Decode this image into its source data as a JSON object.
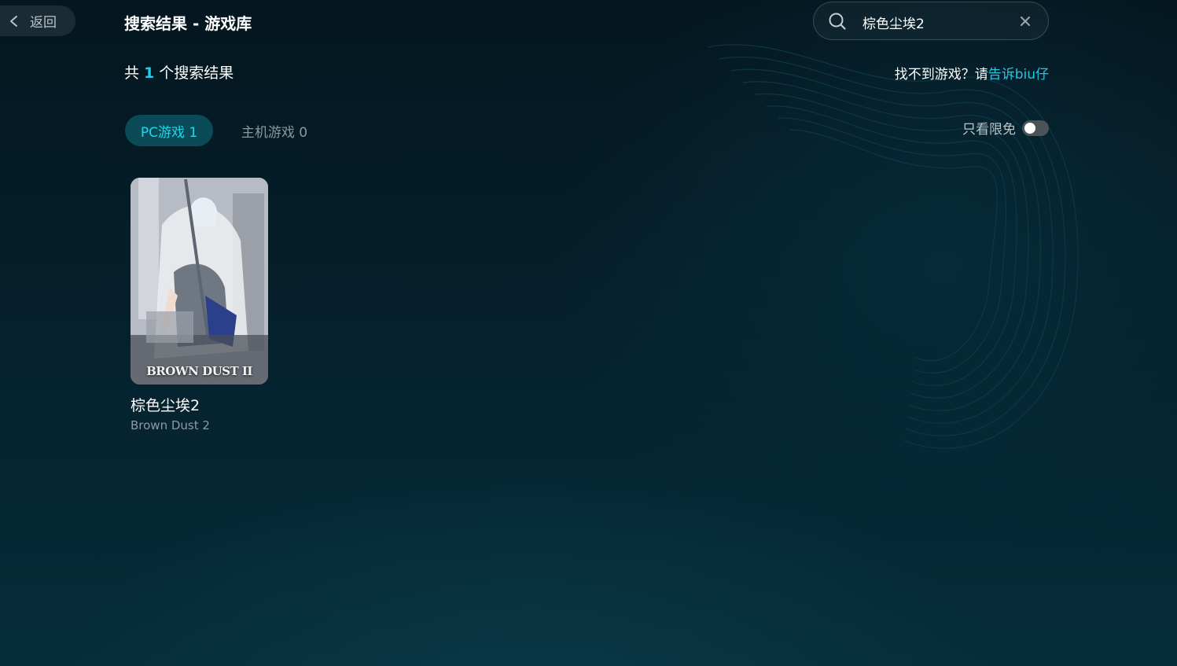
{
  "header": {
    "back_label": "返回",
    "title": "搜索结果 - 游戏库"
  },
  "search": {
    "value": "棕色尘埃2"
  },
  "results": {
    "prefix": "共",
    "count": "1",
    "suffix": "个搜索结果"
  },
  "feedback": {
    "text": "找不到游戏？请",
    "link": "告诉biu仔"
  },
  "tabs": [
    {
      "label": "PC游戏 1",
      "active": true
    },
    {
      "label": "主机游戏 0",
      "active": false
    }
  ],
  "filter": {
    "label": "只看限免",
    "on": false
  },
  "games": [
    {
      "title": "棕色尘埃2",
      "subtitle": "Brown Dust 2",
      "cover_logo": "BROWN DUST II"
    }
  ],
  "colors": {
    "accent": "#1fd0e8",
    "tab_active_bg": "#0b4a57",
    "background": "#05202c"
  },
  "icons": [
    "chevron-left-icon",
    "search-icon",
    "close-icon"
  ]
}
